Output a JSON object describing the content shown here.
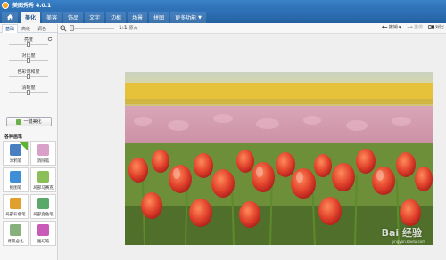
{
  "app": {
    "title": "美图秀秀 4.0.1"
  },
  "nav": {
    "tabs": [
      {
        "label": "美化",
        "active": true
      },
      {
        "label": "美容",
        "active": false
      },
      {
        "label": "饰品",
        "active": false
      },
      {
        "label": "文字",
        "active": false
      },
      {
        "label": "边框",
        "active": false
      },
      {
        "label": "场景",
        "active": false
      },
      {
        "label": "拼图",
        "active": false
      },
      {
        "label": "更多功能",
        "active": false,
        "dropdown": true
      }
    ]
  },
  "toolbar": {
    "fit_label": "1:1",
    "original_label": "原大",
    "undo_label": "撤销",
    "redo_label": "重做",
    "compare_label": "对比"
  },
  "panel": {
    "subtabs": [
      "基础",
      "高级",
      "调色"
    ],
    "sliders": [
      {
        "label": "亮度",
        "value": 0.5
      },
      {
        "label": "对比度",
        "value": 0.5
      },
      {
        "label": "色彩饱和度",
        "value": 0.5
      },
      {
        "label": "清晰度",
        "value": 0.5
      }
    ],
    "onekey_label": "一键美化",
    "section_title": "各种画笔",
    "tools": [
      {
        "label": "涂鸦笔",
        "color": "#4a7fc1",
        "badge": true
      },
      {
        "label": "消除笔",
        "color": "#d9a0c8",
        "badge": false
      },
      {
        "label": "抠图笔",
        "color": "#3f8fd6",
        "badge": false
      },
      {
        "label": "局部马赛克",
        "color": "#8bbf5a",
        "badge": false
      },
      {
        "label": "局部彩色笔",
        "color": "#e0a030",
        "badge": false
      },
      {
        "label": "局部变色笔",
        "color": "#5aa86a",
        "badge": false
      },
      {
        "label": "背景虚化",
        "color": "#88b07a",
        "badge": false
      },
      {
        "label": "魔幻笔",
        "color": "#c85ab8",
        "badge": false
      }
    ]
  },
  "canvas": {
    "watermark": "Bai 经验",
    "watermark_sub": "jingyan.baidu.com"
  }
}
